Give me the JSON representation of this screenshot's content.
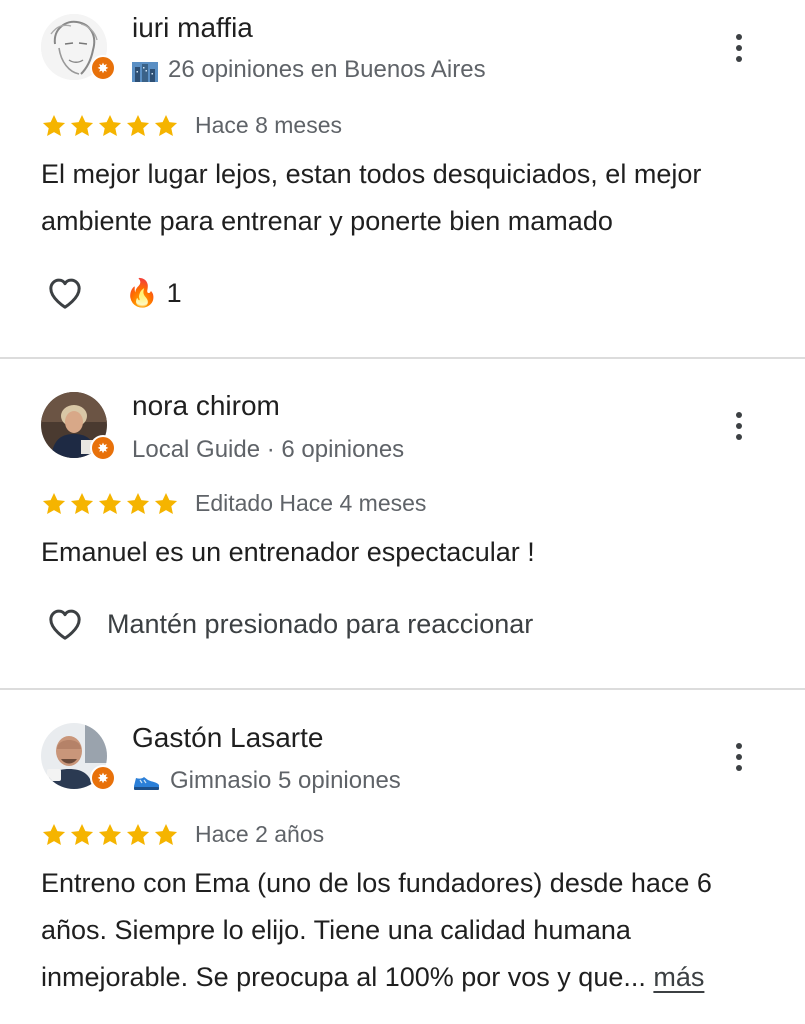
{
  "colors": {
    "star": "#f5b400",
    "badge": "#e8710a",
    "secondary_text": "#5f6368",
    "divider": "#dcdcdc"
  },
  "reviews": [
    {
      "name": "iuri maffia",
      "meta_icon": "city-icon",
      "meta": "26 opiniones en Buenos Aires",
      "rating": 5,
      "date": "Hace 8 meses",
      "text": "El mejor lugar lejos, estan todos desquiciados, el mejor ambiente para entrenar y ponerte bien mamado",
      "reaction_icon": "fire-icon",
      "reaction_emoji": "🔥",
      "reaction_count": "1"
    },
    {
      "name": "nora chirom",
      "meta": "Local Guide · 6 opiniones",
      "rating": 5,
      "date": "Editado Hace 4 meses",
      "text": "Emanuel es un entrenador espectacular !",
      "reaction_hint": "Mantén presionado para reaccionar"
    },
    {
      "name": "Gastón Lasarte",
      "meta_icon": "sneaker-icon",
      "meta": "Gimnasio 5 opiniones",
      "rating": 5,
      "date": "Hace 2 años",
      "text": "Entreno con Ema (uno de los fundadores) desde hace 6 años. Siempre lo elijo. Tiene una calidad humana inmejorable. Se preocupa al 100% por vos y que...",
      "more_label": "más"
    }
  ]
}
